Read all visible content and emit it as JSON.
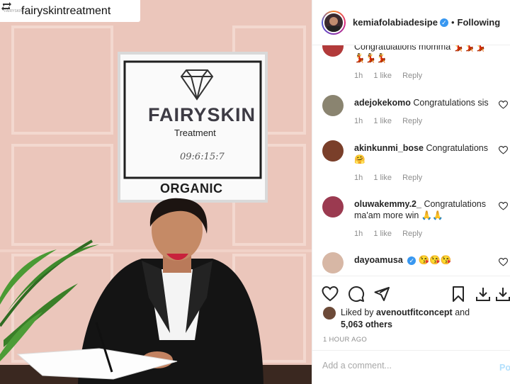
{
  "repost": {
    "username": "fairyskintreatment",
    "avatar_text": "FAIRYSKIN",
    "icon": "repost-icon"
  },
  "sign": {
    "brand": "FAIRYSKIN",
    "sub": "Treatment",
    "code": "09:6:15:7",
    "organic": "ORGANIC",
    "icon": "diamond-icon"
  },
  "header": {
    "username": "kemiafolabiadesipe",
    "verified_icon": "verified-badge-icon",
    "separator": "•",
    "follow_label": "Following"
  },
  "comments": [
    {
      "username": "",
      "text": "Congratulations momma 💃💃💃 💃💃💃",
      "time": "1h",
      "likes": "1 like",
      "reply": "Reply"
    },
    {
      "username": "adejokekomo",
      "text": "Congratulations sis",
      "time": "1h",
      "likes": "1 like",
      "reply": "Reply"
    },
    {
      "username": "akinkunmi_bose",
      "text": "Congratulations 🤗",
      "time": "1h",
      "likes": "1 like",
      "reply": "Reply"
    },
    {
      "username": "oluwakemmy.2_",
      "text": "Congratulations ma'am more win 🙏🙏",
      "time": "1h",
      "likes": "1 like",
      "reply": "Reply"
    },
    {
      "username": "dayoamusa",
      "text": "😘😘😘",
      "time": "",
      "likes": "",
      "reply": ""
    }
  ],
  "actions": {
    "icons": [
      "heart-icon",
      "comment-icon",
      "share-icon",
      "bookmark-icon",
      "download-icon",
      "download-icon-2"
    ]
  },
  "likes": {
    "prefix": "Liked by",
    "user": "avenoutfitconcept",
    "suffix": "and",
    "count": "5,063 others"
  },
  "timestamp": "1 HOUR AGO",
  "comment_box": {
    "placeholder": "Add a comment...",
    "post_label": "Post"
  }
}
